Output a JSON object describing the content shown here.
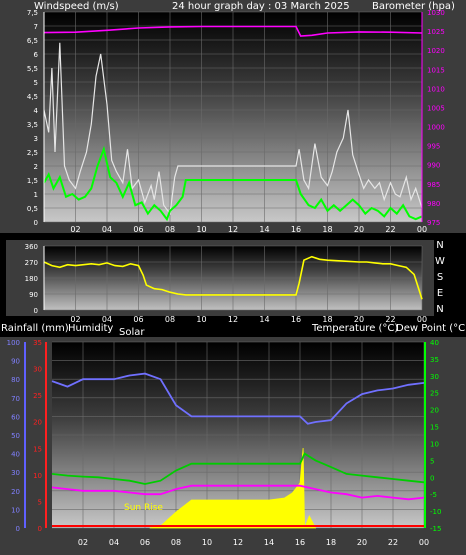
{
  "header": {
    "left_label": "Windspeed (m/s)",
    "title": "24 hour graph day : 03 March 2025",
    "right_label": "Barometer (hpa)"
  },
  "labels_panel3": {
    "rainfall": "Rainfall (mm)",
    "humidity": "Humidity",
    "solar": "Solar",
    "temperature": "Temperature (°C)",
    "dewpoint": "Dew Point (°C)",
    "sunrise": "Sun Rise"
  },
  "colors": {
    "wind_gust": "#e6e6e6",
    "wind_avg": "#00ff00",
    "barometer": "#ff00ff",
    "direction": "#ffff00",
    "humidity": "#7070ff",
    "temperature": "#00cc00",
    "dewpoint": "#ff00ff",
    "solar": "#ffff00",
    "rain": "#ff0000",
    "axis_humidity": "#6060ff",
    "axis_rain": "#ff2020",
    "axis_temp": "#00ff00"
  },
  "chart_data": [
    {
      "type": "line",
      "x_ticks": [
        "02",
        "04",
        "06",
        "08",
        "10",
        "12",
        "14",
        "16",
        "18",
        "20",
        "22",
        "00"
      ],
      "y_left": {
        "label": "Windspeed (m/s)",
        "min": 0,
        "max": 7.5,
        "ticks": [
          "0",
          "0,5",
          "1",
          "1,5",
          "2",
          "2,5",
          "3",
          "3,5",
          "4",
          "4,5",
          "5",
          "5,5",
          "6",
          "6,5",
          "7",
          "7,5"
        ]
      },
      "y_right": {
        "label": "Barometer (hpa)",
        "min": 975,
        "max": 1030,
        "ticks": [
          "975",
          "980",
          "985",
          "990",
          "995",
          "1000",
          "1005",
          "1010",
          "1015",
          "1020",
          "1025",
          "1030"
        ]
      },
      "series": [
        {
          "key": "gust",
          "axis": "left",
          "x": [
            0,
            0.3,
            0.5,
            0.7,
            1,
            1.3,
            1.6,
            2,
            2.3,
            2.7,
            3,
            3.3,
            3.6,
            4,
            4.3,
            4.6,
            5,
            5.3,
            5.6,
            6,
            6.4,
            6.8,
            7,
            7.3,
            7.6,
            8,
            8.3,
            8.5,
            9,
            10,
            12,
            14,
            16,
            16.2,
            16.5,
            16.8,
            17.2,
            17.6,
            18,
            18.3,
            18.6,
            19,
            19.3,
            19.6,
            20,
            20.3,
            20.6,
            21,
            21.3,
            21.6,
            22,
            22.3,
            22.6,
            23,
            23.3,
            23.6,
            24
          ],
          "values": [
            4,
            3.2,
            5.5,
            2.5,
            6.4,
            2,
            1.5,
            1.2,
            1.8,
            2.5,
            3.5,
            5.2,
            6,
            4.2,
            2.2,
            1.8,
            1.4,
            2.6,
            1.2,
            1.5,
            0.7,
            1.3,
            0.8,
            1.8,
            0.6,
            0.3,
            1.6,
            2,
            2,
            2,
            2,
            2,
            2,
            2.6,
            1.5,
            1.2,
            2.8,
            1.6,
            1.3,
            1.8,
            2.5,
            3,
            4,
            2.4,
            1.7,
            1.2,
            1.5,
            1.2,
            1.4,
            0.8,
            1.4,
            1.0,
            0.9,
            1.6,
            0.8,
            1.2,
            0.5
          ]
        },
        {
          "key": "avg",
          "axis": "left",
          "x": [
            0,
            0.3,
            0.6,
            1,
            1.4,
            1.8,
            2.2,
            2.6,
            3,
            3.4,
            3.8,
            4.2,
            4.6,
            5,
            5.4,
            5.8,
            6.2,
            6.6,
            7,
            7.4,
            7.8,
            8,
            8.4,
            8.8,
            9,
            10,
            12,
            14,
            16,
            16.3,
            16.8,
            17.2,
            17.6,
            18,
            18.4,
            18.8,
            19.2,
            19.6,
            20,
            20.4,
            20.8,
            21.2,
            21.6,
            22,
            22.4,
            22.8,
            23.2,
            23.6,
            24
          ],
          "values": [
            1.4,
            1.7,
            1.2,
            1.6,
            0.9,
            1.0,
            0.8,
            0.9,
            1.2,
            2.0,
            2.6,
            1.6,
            1.4,
            0.9,
            1.4,
            0.6,
            0.7,
            0.3,
            0.6,
            0.4,
            0.1,
            0.4,
            0.6,
            0.9,
            1.5,
            1.5,
            1.5,
            1.5,
            1.5,
            1.0,
            0.6,
            0.5,
            0.8,
            0.4,
            0.6,
            0.4,
            0.6,
            0.8,
            0.6,
            0.3,
            0.5,
            0.4,
            0.2,
            0.5,
            0.3,
            0.6,
            0.2,
            0.1,
            0.2
          ]
        },
        {
          "key": "baro",
          "axis": "right",
          "x": [
            0,
            2,
            4,
            6,
            8,
            10,
            12,
            14,
            16,
            16.3,
            17,
            18,
            20,
            22,
            24
          ],
          "values": [
            1024.6,
            1024.7,
            1025.2,
            1025.8,
            1026.1,
            1026.2,
            1026.2,
            1026.2,
            1026.2,
            1023.7,
            1023.9,
            1024.5,
            1024.8,
            1024.7,
            1024.5
          ]
        }
      ]
    },
    {
      "type": "line",
      "x_ticks": [
        "02",
        "04",
        "06",
        "08",
        "10",
        "12",
        "14",
        "16",
        "18",
        "20",
        "22",
        "00"
      ],
      "y_left": {
        "min": 0,
        "max": 360,
        "ticks": [
          "0",
          "90",
          "180",
          "270",
          "360"
        ]
      },
      "y_right_labels": [
        "N",
        "W",
        "S",
        "E",
        "N"
      ],
      "series": [
        {
          "key": "dir",
          "x": [
            0,
            0.5,
            1,
            1.5,
            2,
            2.5,
            3,
            3.5,
            4,
            4.5,
            5,
            5.5,
            6,
            6.3,
            6.5,
            7,
            7.5,
            8,
            8.5,
            9,
            10,
            12,
            14,
            16,
            16.2,
            16.5,
            17,
            17.5,
            18,
            19,
            20,
            20.5,
            21,
            21.5,
            22,
            22.5,
            23,
            23.5,
            24
          ],
          "values": [
            270,
            250,
            240,
            255,
            250,
            255,
            260,
            255,
            265,
            250,
            245,
            260,
            250,
            195,
            140,
            120,
            115,
            100,
            90,
            85,
            85,
            85,
            85,
            85,
            150,
            280,
            300,
            285,
            280,
            275,
            270,
            270,
            265,
            260,
            260,
            250,
            240,
            200,
            60
          ]
        }
      ]
    },
    {
      "type": "line",
      "x_ticks": [
        "02",
        "04",
        "06",
        "08",
        "10",
        "12",
        "14",
        "16",
        "18",
        "20",
        "22",
        "00"
      ],
      "y_humidity": {
        "label": "Humidity",
        "min": 0,
        "max": 100,
        "ticks": [
          "0",
          "10",
          "20",
          "30",
          "40",
          "50",
          "60",
          "70",
          "80",
          "90",
          "100"
        ]
      },
      "y_rain": {
        "label": "Rainfall (mm)",
        "min": 0,
        "max": 35,
        "ticks": [
          "0",
          "5",
          "10",
          "15",
          "20",
          "25",
          "30",
          "35"
        ]
      },
      "y_temp": {
        "label": "Temperature (°C)",
        "min": -15,
        "max": 40,
        "ticks": [
          "-15",
          "-10",
          "-5",
          "0",
          "5",
          "10",
          "15",
          "20",
          "25",
          "30",
          "35",
          "40"
        ]
      },
      "series": [
        {
          "key": "humidity",
          "x": [
            0,
            1,
            2,
            3,
            4,
            5,
            6,
            7,
            8,
            9,
            10,
            12,
            14,
            16,
            16.5,
            17,
            18,
            19,
            20,
            21,
            22,
            23,
            24
          ],
          "values": [
            79,
            76,
            80,
            80,
            80,
            82,
            83,
            80,
            66,
            60,
            60,
            60,
            60,
            60,
            56,
            57,
            58,
            67,
            72,
            74,
            75,
            77,
            78
          ]
        },
        {
          "key": "temp",
          "x": [
            0,
            1,
            2,
            3,
            4,
            5,
            6,
            7,
            8,
            9,
            10,
            12,
            14,
            16,
            16.3,
            17,
            18,
            19,
            20,
            21,
            22,
            23,
            24
          ],
          "values": [
            1,
            0.5,
            0.2,
            0,
            -0.5,
            -1,
            -2,
            -1,
            2,
            4,
            4,
            4,
            4,
            4,
            7,
            5,
            3,
            1,
            0.5,
            0,
            -0.5,
            -1,
            -1.5
          ]
        },
        {
          "key": "dew",
          "x": [
            0,
            1,
            2,
            3,
            4,
            5,
            6,
            7,
            8,
            9,
            10,
            12,
            14,
            16,
            17,
            18,
            19,
            20,
            21,
            22,
            23,
            24
          ],
          "values": [
            -3,
            -3.5,
            -4,
            -4,
            -4,
            -4.5,
            -5,
            -5,
            -3.5,
            -2.5,
            -2.5,
            -2.5,
            -2.5,
            -2.5,
            -3.5,
            -4.5,
            -5,
            -6,
            -5.5,
            -6,
            -6.5,
            -6
          ]
        },
        {
          "key": "solar",
          "x": [
            6.3,
            7,
            8,
            9,
            10,
            11,
            12,
            13,
            14,
            15,
            15.5,
            16,
            16.2,
            16.3,
            16.6,
            17
          ],
          "values": [
            0,
            2,
            16,
            28,
            28,
            28,
            28,
            28,
            28,
            30,
            35,
            45,
            80,
            0,
            12,
            0
          ]
        }
      ]
    }
  ]
}
